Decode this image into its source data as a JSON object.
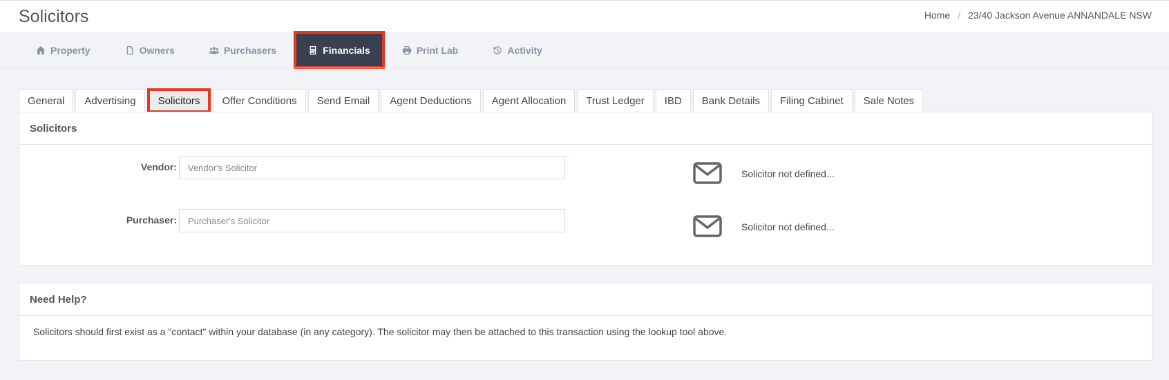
{
  "header": {
    "title": "Solicitors",
    "breadcrumb": [
      "Home",
      "23/40 Jackson Avenue ANNANDALE NSW"
    ]
  },
  "nav": [
    {
      "label": "Property",
      "icon": "home-icon"
    },
    {
      "label": "Owners",
      "icon": "file-icon"
    },
    {
      "label": "Purchasers",
      "icon": "users-icon"
    },
    {
      "label": "Financials",
      "icon": "calculator-icon",
      "active": true
    },
    {
      "label": "Print Lab",
      "icon": "printer-icon"
    },
    {
      "label": "Activity",
      "icon": "history-icon"
    }
  ],
  "tabs": [
    {
      "label": "General"
    },
    {
      "label": "Advertising"
    },
    {
      "label": "Solicitors",
      "active": true
    },
    {
      "label": "Offer Conditions"
    },
    {
      "label": "Send Email"
    },
    {
      "label": "Agent Deductions"
    },
    {
      "label": "Agent Allocation"
    },
    {
      "label": "Trust Ledger"
    },
    {
      "label": "IBD"
    },
    {
      "label": "Bank Details"
    },
    {
      "label": "Filing Cabinet"
    },
    {
      "label": "Sale Notes"
    }
  ],
  "solicitors_panel": {
    "title": "Solicitors",
    "vendor": {
      "label": "Vendor:",
      "placeholder": "Vendor's Solicitor",
      "value": "",
      "status": "Solicitor not defined..."
    },
    "purchaser": {
      "label": "Purchaser:",
      "placeholder": "Purchaser's Solicitor",
      "value": "",
      "status": "Solicitor not defined..."
    }
  },
  "help_panel": {
    "title": "Need Help?",
    "text": "Solicitors should first exist as a \"contact\" within your database (in any category). The solicitor may then be attached to this transaction using the lookup tool above."
  },
  "colors": {
    "active_nav_bg": "#394051",
    "highlight_border": "#e23a22",
    "page_bg": "#f2f3f6",
    "nav_text": "#8a93a6"
  }
}
